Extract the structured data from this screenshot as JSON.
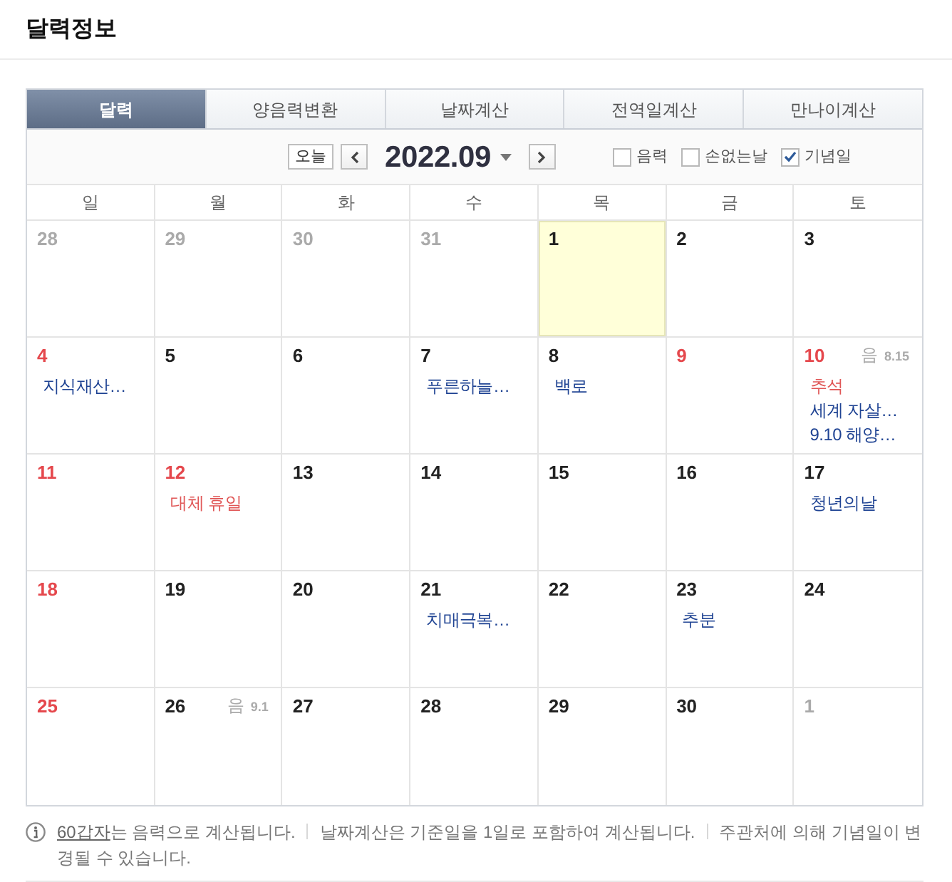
{
  "title": "달력정보",
  "tabs": [
    {
      "label": "달력",
      "selected": true
    },
    {
      "label": "양음력변환",
      "selected": false
    },
    {
      "label": "날짜계산",
      "selected": false
    },
    {
      "label": "전역일계산",
      "selected": false
    },
    {
      "label": "만나이계산",
      "selected": false
    }
  ],
  "toolbar": {
    "today_button": "오늘",
    "month": "2022.09",
    "filters": [
      {
        "label": "음력",
        "checked": false
      },
      {
        "label": "손없는날",
        "checked": false
      },
      {
        "label": "기념일",
        "checked": true
      }
    ]
  },
  "weekdays": [
    "일",
    "월",
    "화",
    "수",
    "목",
    "금",
    "토"
  ],
  "weeks": [
    [
      {
        "day": "28",
        "other_month": true,
        "holiday": false,
        "today": false
      },
      {
        "day": "29",
        "other_month": true,
        "holiday": false,
        "today": false
      },
      {
        "day": "30",
        "other_month": true,
        "holiday": false,
        "today": false
      },
      {
        "day": "31",
        "other_month": true,
        "holiday": false,
        "today": false
      },
      {
        "day": "1",
        "other_month": false,
        "holiday": false,
        "today": true
      },
      {
        "day": "2",
        "other_month": false,
        "holiday": false,
        "today": false
      },
      {
        "day": "3",
        "other_month": false,
        "holiday": false,
        "today": false
      }
    ],
    [
      {
        "day": "4",
        "other_month": false,
        "holiday": true,
        "today": false,
        "events": [
          {
            "label": "지식재산…",
            "kind": "memorial"
          }
        ]
      },
      {
        "day": "5",
        "other_month": false,
        "holiday": false,
        "today": false
      },
      {
        "day": "6",
        "other_month": false,
        "holiday": false,
        "today": false
      },
      {
        "day": "7",
        "other_month": false,
        "holiday": false,
        "today": false,
        "events": [
          {
            "label": "푸른하늘…",
            "kind": "memorial"
          }
        ]
      },
      {
        "day": "8",
        "other_month": false,
        "holiday": false,
        "today": false,
        "events": [
          {
            "label": "백로",
            "kind": "memorial"
          }
        ]
      },
      {
        "day": "9",
        "other_month": false,
        "holiday": true,
        "today": false
      },
      {
        "day": "10",
        "other_month": false,
        "holiday": true,
        "today": false,
        "lunar": {
          "label": "음",
          "date": "8.15"
        },
        "events": [
          {
            "label": "추석",
            "kind": "holiday"
          },
          {
            "label": "세계 자살…",
            "kind": "memorial"
          },
          {
            "label": "9.10 해양…",
            "kind": "memorial"
          }
        ]
      }
    ],
    [
      {
        "day": "11",
        "other_month": false,
        "holiday": true,
        "today": false
      },
      {
        "day": "12",
        "other_month": false,
        "holiday": true,
        "today": false,
        "events": [
          {
            "label": "대체 휴일",
            "kind": "holiday"
          }
        ]
      },
      {
        "day": "13",
        "other_month": false,
        "holiday": false,
        "today": false
      },
      {
        "day": "14",
        "other_month": false,
        "holiday": false,
        "today": false
      },
      {
        "day": "15",
        "other_month": false,
        "holiday": false,
        "today": false
      },
      {
        "day": "16",
        "other_month": false,
        "holiday": false,
        "today": false
      },
      {
        "day": "17",
        "other_month": false,
        "holiday": false,
        "today": false,
        "events": [
          {
            "label": "청년의날",
            "kind": "memorial"
          }
        ]
      }
    ],
    [
      {
        "day": "18",
        "other_month": false,
        "holiday": true,
        "today": false
      },
      {
        "day": "19",
        "other_month": false,
        "holiday": false,
        "today": false
      },
      {
        "day": "20",
        "other_month": false,
        "holiday": false,
        "today": false
      },
      {
        "day": "21",
        "other_month": false,
        "holiday": false,
        "today": false,
        "events": [
          {
            "label": "치매극복…",
            "kind": "memorial"
          }
        ]
      },
      {
        "day": "22",
        "other_month": false,
        "holiday": false,
        "today": false
      },
      {
        "day": "23",
        "other_month": false,
        "holiday": false,
        "today": false,
        "events": [
          {
            "label": "추분",
            "kind": "memorial"
          }
        ]
      },
      {
        "day": "24",
        "other_month": false,
        "holiday": false,
        "today": false
      }
    ],
    [
      {
        "day": "25",
        "other_month": false,
        "holiday": true,
        "today": false
      },
      {
        "day": "26",
        "other_month": false,
        "holiday": false,
        "today": false,
        "lunar": {
          "label": "음",
          "date": "9.1"
        }
      },
      {
        "day": "27",
        "other_month": false,
        "holiday": false,
        "today": false
      },
      {
        "day": "28",
        "other_month": false,
        "holiday": false,
        "today": false
      },
      {
        "day": "29",
        "other_month": false,
        "holiday": false,
        "today": false
      },
      {
        "day": "30",
        "other_month": false,
        "holiday": false,
        "today": false
      },
      {
        "day": "1",
        "other_month": true,
        "holiday": false,
        "today": false
      }
    ]
  ],
  "notes": [
    {
      "link": "60갑자",
      "text": "는 음력으로 계산됩니다."
    },
    {
      "text": "날짜계산은 기준일을 1일로 포함하여 계산됩니다."
    },
    {
      "text": "주관처에 의해 기념일이 변경될 수 있습니다."
    }
  ]
}
